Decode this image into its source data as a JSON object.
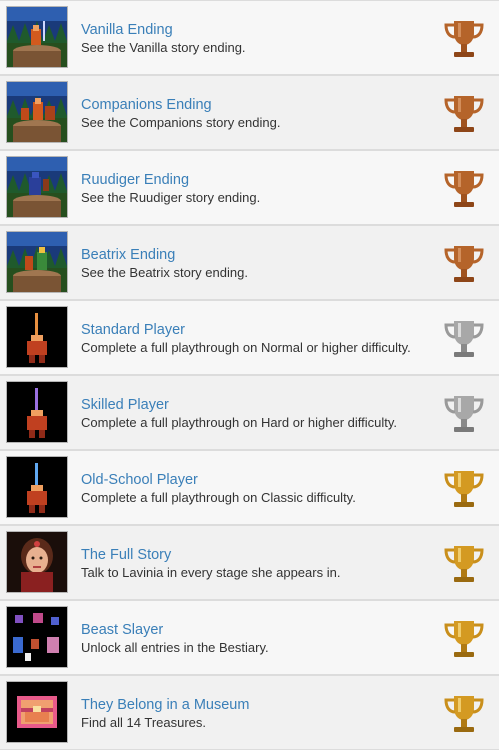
{
  "achievements": [
    {
      "title": "Vanilla Ending",
      "description": "See the Vanilla story ending.",
      "trophy": "bronze-trophy-icon",
      "image": "cliff-scene-vanilla"
    },
    {
      "title": "Companions Ending",
      "description": "See the Companions story ending.",
      "trophy": "bronze-trophy-icon",
      "image": "cliff-scene-companions"
    },
    {
      "title": "Ruudiger Ending",
      "description": "See the Ruudiger story ending.",
      "trophy": "bronze-trophy-icon",
      "image": "cliff-scene-ruudiger"
    },
    {
      "title": "Beatrix Ending",
      "description": "See the Beatrix story ending.",
      "trophy": "bronze-trophy-icon",
      "image": "cliff-scene-beatrix"
    },
    {
      "title": "Standard Player",
      "description": "Complete a full playthrough on Normal or higher difficulty.",
      "trophy": "silver-trophy-icon",
      "image": "knight-raising-sword"
    },
    {
      "title": "Skilled Player",
      "description": "Complete a full playthrough on Hard or higher difficulty.",
      "trophy": "silver-trophy-icon",
      "image": "knight-raising-sword-purple"
    },
    {
      "title": "Old-School Player",
      "description": "Complete a full playthrough on Classic difficulty.",
      "trophy": "gold-trophy-icon",
      "image": "knight-raising-sword-blue"
    },
    {
      "title": "The Full Story",
      "description": "Talk to Lavinia in every stage she appears in.",
      "trophy": "gold-trophy-icon",
      "image": "lavinia-portrait"
    },
    {
      "title": "Beast Slayer",
      "description": "Unlock all entries in the Bestiary.",
      "trophy": "gold-trophy-icon",
      "image": "bestiary-monsters"
    },
    {
      "title": "They Belong in a Museum",
      "description": "Find all 14 Treasures.",
      "trophy": "gold-trophy-icon",
      "image": "treasure-chest"
    }
  ],
  "colors": {
    "bronze": "#b5642a",
    "silver": "#9a9a9a",
    "gold": "#c98f1c",
    "title": "#3a7fb8"
  }
}
